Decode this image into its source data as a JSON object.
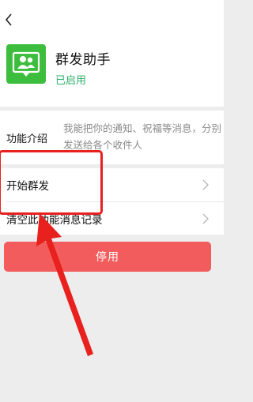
{
  "header": {
    "back_icon": "chevron-left-icon",
    "app_icon": "group-users-icon",
    "app_name": "群发助手",
    "status": "已启用"
  },
  "intro": {
    "label": "功能介绍",
    "text": "我能把你的通知、祝福等消息，分别发送给各个收件人"
  },
  "menu": {
    "items": [
      {
        "label": "开始群发",
        "icon": "chevron-right-icon"
      },
      {
        "label": "清空此功能消息记录",
        "icon": "chevron-right-icon"
      }
    ]
  },
  "actions": {
    "disable_label": "停用"
  },
  "colors": {
    "accent_green": "#3dbd3d",
    "status_green": "#2aae67",
    "danger_red": "#f25c5c",
    "annotation_red": "#e8201e",
    "background": "#ededed"
  }
}
